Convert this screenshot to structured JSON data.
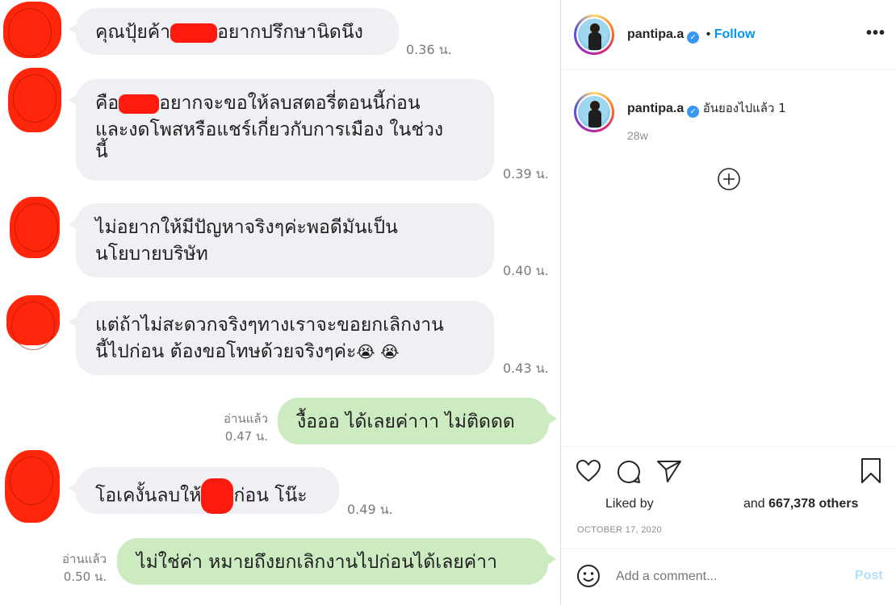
{
  "chat": {
    "messages": [
      {
        "side": "left",
        "parts": [
          "คุณปุ้ยค้า",
          "อยากปรึกษานิดนึง"
        ],
        "time": "0.36 น."
      },
      {
        "side": "left",
        "parts": [
          "คือ",
          "อยากจะขอให้ลบสตอรี่ตอนนี้ก่อน"
        ],
        "line2": "และงดโพสหรือแชร์เกี่ยวกับการเมือง ในช่วง",
        "line3": "นี้",
        "time": "0.39 น."
      },
      {
        "side": "left",
        "line1": "ไม่อยากให้มีปัญหาจริงๆค่ะพอดีมันเป็น",
        "line2": "นโยบายบริษัท",
        "time": "0.40 น."
      },
      {
        "side": "left",
        "line1": "แต่ถ้าไม่สะดวกจริงๆทางเราจะขอยกเลิกงาน",
        "line2": "นี้ไปก่อน ต้องขอโทษด้วยจริงๆค่ะ",
        "emoji": "😭 😭",
        "time": "0.43 น."
      },
      {
        "side": "right",
        "text": "งื้อออ ได้เลยค่าาา ไม่ติดดด",
        "read": "อ่านแล้ว",
        "time": "0.47 น."
      },
      {
        "side": "left",
        "parts": [
          "โอเคงั้นลบให้",
          "ก่อน โน๊ะ"
        ],
        "time": "0.49 น."
      },
      {
        "side": "right",
        "text": "ไม่ใช่ค่า หมายถึงยกเลิกงานไปก่อนได้เลยค่าา",
        "read": "อ่านแล้ว",
        "time": "0.50 น."
      }
    ]
  },
  "ig": {
    "header": {
      "username": "pantipa.a",
      "verified_icon": "verified-badge-icon",
      "separator": "•",
      "follow": "Follow",
      "more_icon": "more-options-icon"
    },
    "caption": {
      "username": "pantipa.a",
      "text": "อันยองไปแล้ว 1",
      "age": "28w"
    },
    "load_more_icon": "plus-circle-icon",
    "actions": {
      "like_icon": "heart-icon",
      "comment_icon": "comment-icon",
      "share_icon": "share-icon",
      "save_icon": "bookmark-icon"
    },
    "likes": {
      "prefix": "Liked by",
      "middle": "and",
      "count": "667,378 others"
    },
    "date": "OCTOBER 17, 2020",
    "comment": {
      "placeholder": "Add a comment...",
      "post": "Post",
      "emoji_icon": "smiley-icon"
    },
    "colors": {
      "follow": "#0095f6",
      "verified": "#3897f0",
      "post_disabled": "#b2dffc"
    }
  }
}
